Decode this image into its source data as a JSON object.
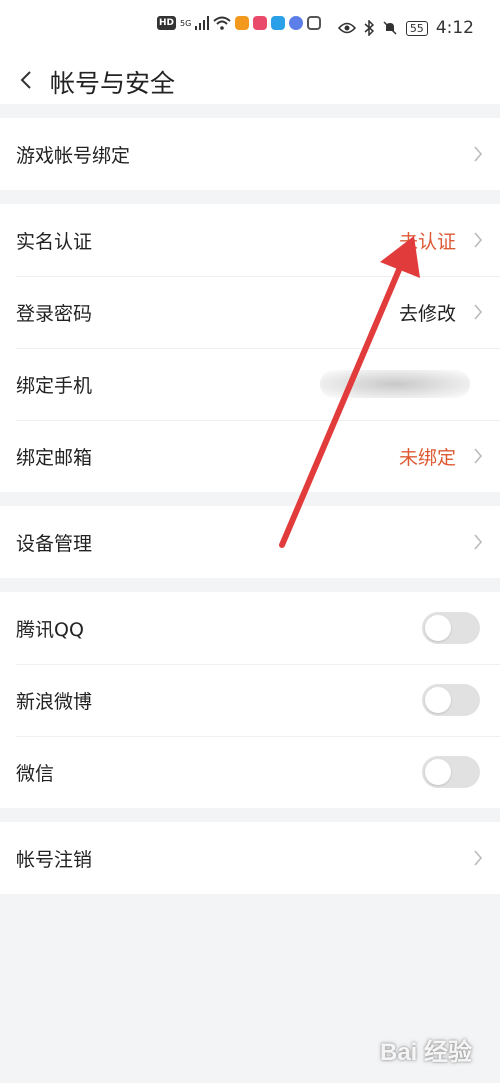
{
  "status_bar": {
    "network": "HD",
    "signal": "5G",
    "battery": "55",
    "time": "4:12"
  },
  "header": {
    "title": "帐号与安全"
  },
  "sections": [
    {
      "rows": [
        {
          "label": "游戏帐号绑定",
          "type": "chevron"
        }
      ]
    },
    {
      "rows": [
        {
          "label": "实名认证",
          "value": "未认证",
          "value_color": "#dd5a35",
          "type": "chevron"
        },
        {
          "label": "登录密码",
          "value": "去修改",
          "type": "chevron"
        },
        {
          "label": "绑定手机",
          "value": "",
          "type": "blurred"
        },
        {
          "label": "绑定邮箱",
          "value": "未绑定",
          "value_color": "#dd5a35",
          "type": "chevron"
        }
      ]
    },
    {
      "rows": [
        {
          "label": "设备管理",
          "type": "chevron"
        }
      ]
    },
    {
      "rows": [
        {
          "label": "腾讯QQ",
          "type": "toggle",
          "checked": false
        },
        {
          "label": "新浪微博",
          "type": "toggle",
          "checked": false
        },
        {
          "label": "微信",
          "type": "toggle",
          "checked": false
        }
      ]
    },
    {
      "rows": [
        {
          "label": "帐号注销",
          "type": "chevron"
        }
      ]
    }
  ],
  "watermark": "Bai 经验",
  "colors": {
    "accent_red": "#dd5a35",
    "arrow": "#e23b3b",
    "background": "#f3f4f6"
  }
}
